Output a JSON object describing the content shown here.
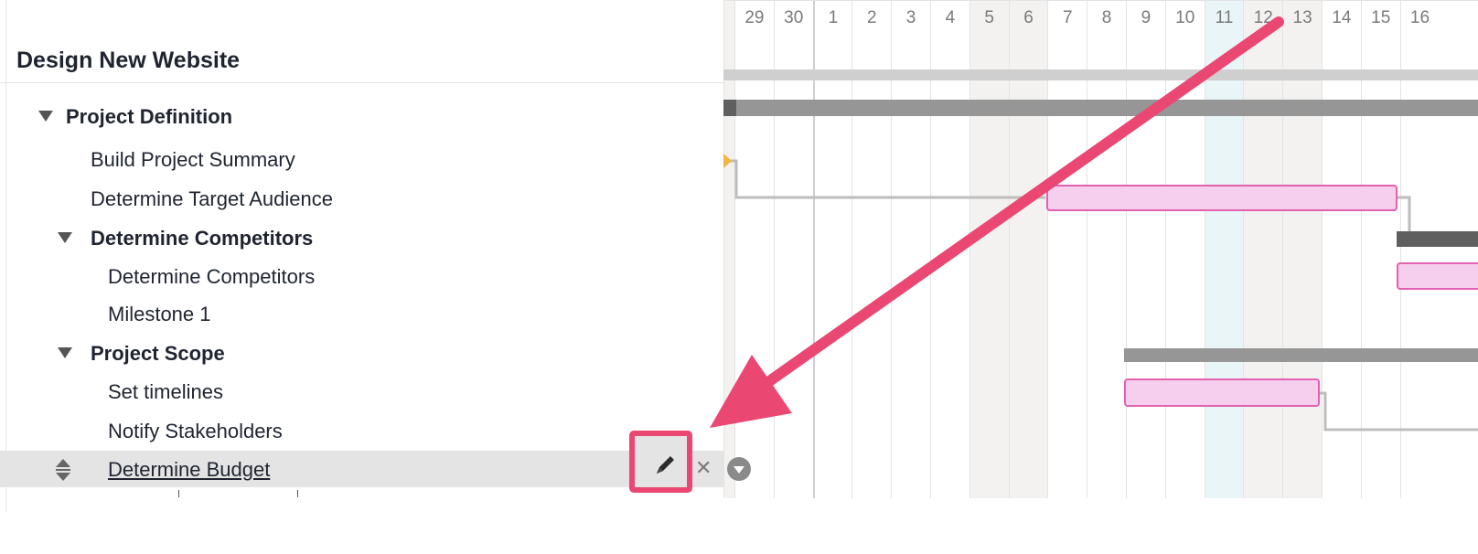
{
  "project": {
    "title": "Design New Website"
  },
  "tasks": [
    {
      "label": "Project Definition",
      "bold": true,
      "group": true
    },
    {
      "label": "Build Project Summary",
      "bold": false
    },
    {
      "label": "Determine Target Audience",
      "bold": false
    },
    {
      "label": "Determine Competitors",
      "bold": true,
      "group": true
    },
    {
      "label": "Determine Competitors",
      "bold": false
    },
    {
      "label": "Milestone 1",
      "bold": false
    },
    {
      "label": "Project Scope",
      "bold": true,
      "group": true
    },
    {
      "label": "Set timelines",
      "bold": false
    },
    {
      "label": "Notify Stakeholders",
      "bold": false
    },
    {
      "label": "Determine Budget",
      "bold": false,
      "selected": true
    }
  ],
  "timeline": {
    "days": [
      "29",
      "30",
      "1",
      "2",
      "3",
      "4",
      "5",
      "6",
      "7",
      "8",
      "9",
      "10",
      "11",
      "12",
      "13",
      "14",
      "15",
      "16"
    ],
    "weekend_days": [
      "5",
      "6",
      "12",
      "13"
    ],
    "today": "11"
  },
  "icons": {
    "edit": "pencil-icon",
    "remove": "close-icon",
    "menu": "chevron-down-circle-icon",
    "reorder": "reorder-handle-icon"
  },
  "colors": {
    "task_bar": "#f6cfee",
    "task_bar_border": "#e262b0",
    "summary_bar": "#969696",
    "arrow": "#ea4872",
    "highlight_box": "#ea4872",
    "today_column": "#eaf5f8",
    "weekend_column": "#f3f2f0"
  },
  "remove_glyph": "✕"
}
